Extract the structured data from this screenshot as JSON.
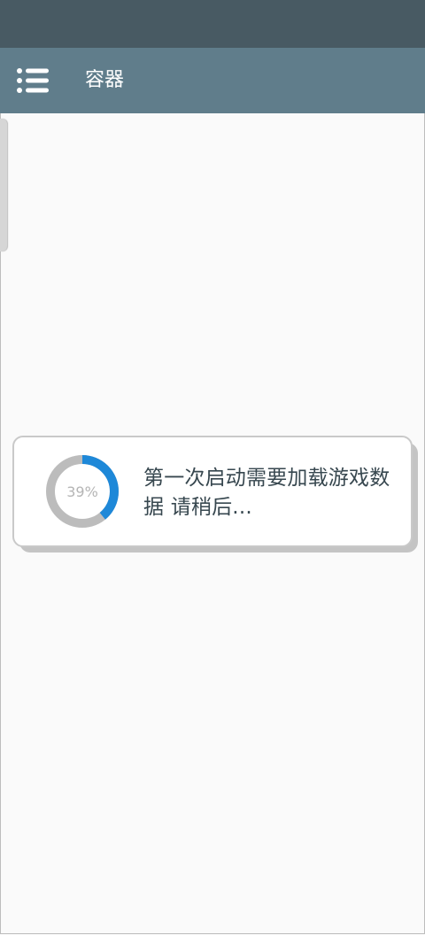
{
  "app_bar": {
    "title": "容器",
    "menu_icon": "menu-list-icon"
  },
  "loading_dialog": {
    "progress_percent": 39,
    "progress_label": "39%",
    "message": "第一次启动需要加载游戏数据 请稍后...",
    "colors": {
      "progress": "#1e88d8",
      "track": "#bcbcbc",
      "message": "#37474f"
    }
  },
  "theme": {
    "status_bar": "#485a63",
    "app_bar": "#607d8b",
    "background": "#fafafa"
  }
}
